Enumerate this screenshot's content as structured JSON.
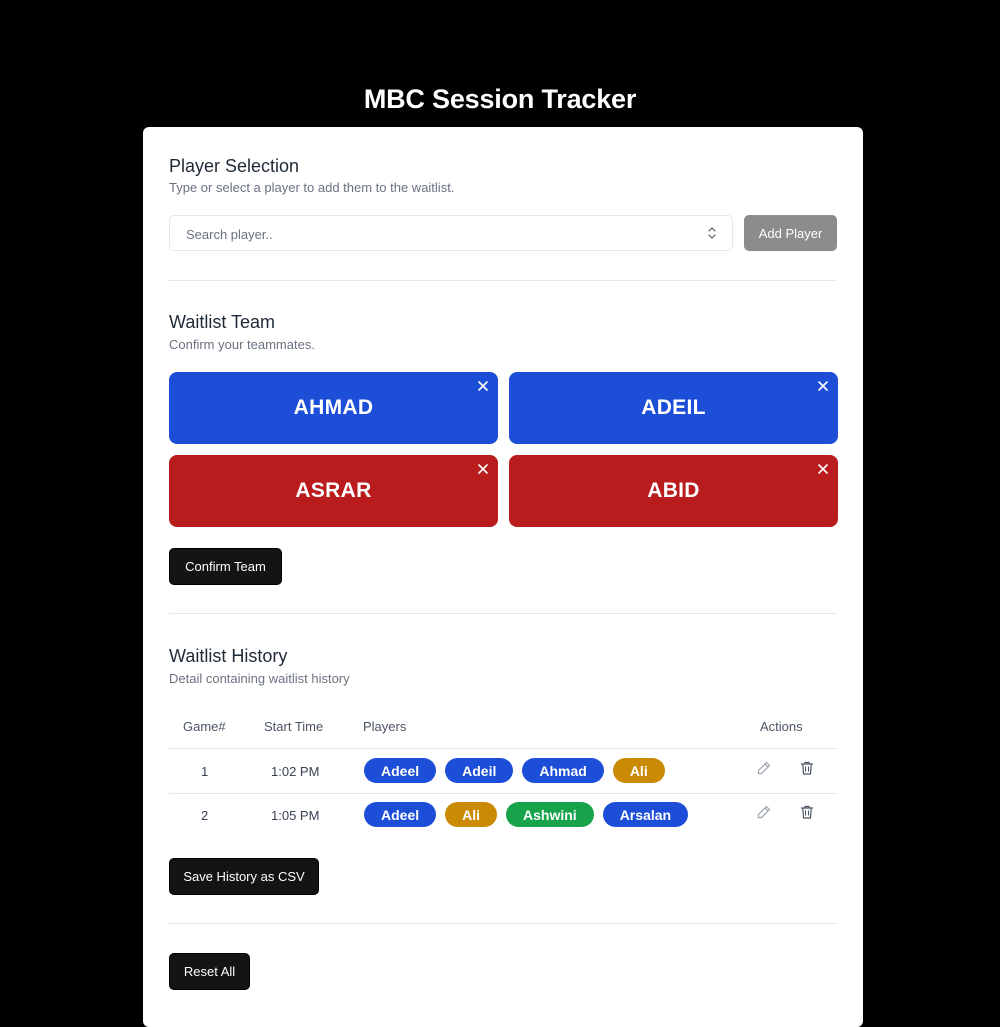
{
  "app": {
    "title": "MBC Session Tracker"
  },
  "player_selection": {
    "title": "Player Selection",
    "subtitle": "Type or select a player to add them to the waitlist.",
    "search": {
      "placeholder": "Search player..",
      "value": ""
    },
    "add_button": "Add Player"
  },
  "waitlist_team": {
    "title": "Waitlist Team",
    "subtitle": "Confirm your teammates.",
    "players": [
      {
        "name": "AHMAD",
        "color": "#1d4ed8"
      },
      {
        "name": "ADEIL",
        "color": "#1d4ed8"
      },
      {
        "name": "ASRAR",
        "color": "#b91c1c"
      },
      {
        "name": "ABID",
        "color": "#b91c1c"
      }
    ],
    "confirm_button": "Confirm Team"
  },
  "waitlist_history": {
    "title": "Waitlist History",
    "subtitle": "Detail containing waitlist history",
    "columns": [
      "Game#",
      "Start Time",
      "Players",
      "Actions"
    ],
    "rows": [
      {
        "game": "1",
        "start_time": "1:02 PM",
        "players": [
          {
            "name": "Adeel",
            "color": "#1d4ed8"
          },
          {
            "name": "Adeil",
            "color": "#1d4ed8"
          },
          {
            "name": "Ahmad",
            "color": "#1d4ed8"
          },
          {
            "name": "Ali",
            "color": "#ca8a04"
          }
        ]
      },
      {
        "game": "2",
        "start_time": "1:05 PM",
        "players": [
          {
            "name": "Adeel",
            "color": "#1d4ed8"
          },
          {
            "name": "Ali",
            "color": "#ca8a04"
          },
          {
            "name": "Ashwini",
            "color": "#16a34a"
          },
          {
            "name": "Arsalan",
            "color": "#1d4ed8"
          }
        ]
      }
    ],
    "row_actions": {
      "edit_icon": "pencil-icon",
      "delete_icon": "trash-icon"
    },
    "save_button": "Save History as CSV"
  },
  "reset_button": "Reset All",
  "icons": {
    "search_toggle": "chevron-updown-icon",
    "remove_player": "close-icon"
  }
}
